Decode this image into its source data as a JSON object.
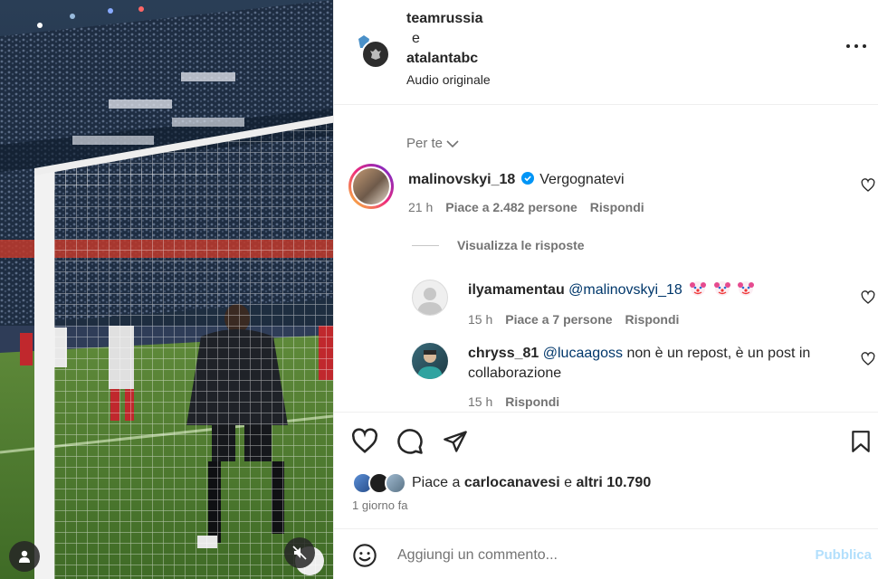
{
  "post": {
    "author1": "teamrussia",
    "conjunction": "e",
    "author2": "atalantabc",
    "audio": "Audio originale"
  },
  "filter": {
    "label": "Per te",
    "icon": "chevron-down-icon"
  },
  "comments": [
    {
      "username": "malinovskyi_18",
      "verified": true,
      "text": "Vergognatevi",
      "time": "21 h",
      "likes": "Piace a 2.482 persone",
      "reply": "Rispondi"
    }
  ],
  "view_replies": "Visualizza le risposte",
  "replies": [
    {
      "username": "ilyamamentau",
      "mention": "@malinovskyi_18",
      "emojis": [
        "clown-face",
        "clown-face",
        "clown-face"
      ],
      "time": "15 h",
      "likes": "Piace a 7 persone",
      "reply": "Rispondi"
    },
    {
      "username": "chryss_81",
      "mention": "@lucaagoss",
      "text": "non è un repost, è un post in collaborazione",
      "time": "15 h",
      "reply": "Rispondi"
    }
  ],
  "liked_by": {
    "prefix": "Piace a",
    "user": "carlocanavesi",
    "joiner": "e",
    "others": "altri 10.790"
  },
  "time_ago": "1 giorno fa",
  "add_comment": {
    "placeholder": "Aggiungi un commento...",
    "publish": "Pubblica"
  },
  "colors": {
    "text": "#262626",
    "secondary": "#737373",
    "mention": "#00376b",
    "verified": "#0095f6",
    "publish_disabled": "#b2dffc"
  }
}
